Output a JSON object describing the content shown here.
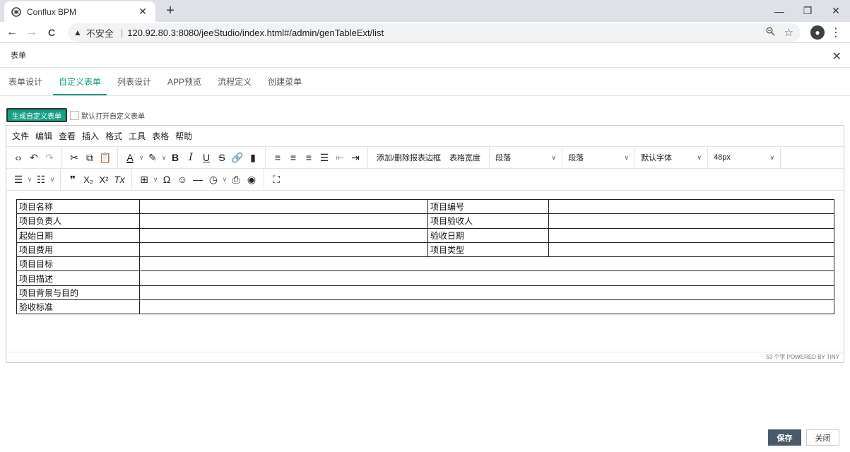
{
  "browser": {
    "tab_title": "Conflux BPM",
    "tab_close": "✕",
    "new_tab": "+",
    "minimize": "—",
    "restore": "❐",
    "close": "✕",
    "back": "←",
    "forward": "→",
    "reload": "C",
    "insecure_label": "不安全",
    "url": "120.92.80.3:8080/jeeStudio/index.html#/admin/genTableExt/list",
    "menu": "⋮"
  },
  "modal": {
    "title": "表单",
    "close": "✕"
  },
  "tabs": [
    {
      "label": "表单设计",
      "active": false
    },
    {
      "label": "自定义表单",
      "active": true
    },
    {
      "label": "列表设计",
      "active": false
    },
    {
      "label": "APP预览",
      "active": false
    },
    {
      "label": "流程定义",
      "active": false
    },
    {
      "label": "创建菜单",
      "active": false
    }
  ],
  "options": {
    "generate_button": "生成自定义表单",
    "default_open_label": "默认打开自定义表单"
  },
  "editor": {
    "menubar": [
      "文件",
      "编辑",
      "查看",
      "插入",
      "格式",
      "工具",
      "表格",
      "帮助"
    ],
    "toolbar": {
      "table_border_label": "添加/删除报表边框",
      "table_width_label": "表格宽度",
      "block_select_1": "段落",
      "block_select_2": "段落",
      "font_select": "默认字体",
      "size_select": "48px"
    },
    "status": "53 个字  POWERED BY TINY"
  },
  "form_table": {
    "rows": [
      [
        "项目名称",
        "",
        "项目编号",
        ""
      ],
      [
        "项目负责人",
        "",
        "项目验收人",
        ""
      ],
      [
        "起始日期",
        "",
        "验收日期",
        ""
      ],
      [
        "项目费用",
        "",
        "项目类型",
        ""
      ],
      [
        "项目目标",
        ""
      ],
      [
        "项目描述",
        ""
      ],
      [
        "项目背景与目的",
        ""
      ],
      [
        "验收标准",
        ""
      ]
    ]
  },
  "footer": {
    "save": "保存",
    "close": "关闭"
  }
}
